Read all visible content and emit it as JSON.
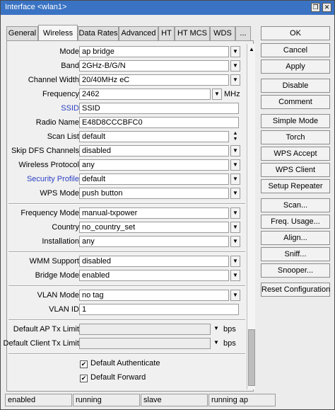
{
  "window": {
    "title": "Interface <wlan1>"
  },
  "tabs": [
    "General",
    "Wireless",
    "Data Rates",
    "Advanced",
    "HT",
    "HT MCS",
    "WDS",
    "..."
  ],
  "active_tab": "Wireless",
  "fields": {
    "mode": {
      "label": "Mode:",
      "value": "ap bridge"
    },
    "band": {
      "label": "Band:",
      "value": "2GHz-B/G/N"
    },
    "channel_width": {
      "label": "Channel Width:",
      "value": "20/40MHz eC"
    },
    "frequency": {
      "label": "Frequency:",
      "value": "2462",
      "unit": "MHz"
    },
    "ssid": {
      "label": "SSID:",
      "value": "SSID"
    },
    "radio_name": {
      "label": "Radio Name:",
      "value": "E48D8CCCBFC0"
    },
    "scan_list": {
      "label": "Scan List:",
      "value": "default"
    },
    "skip_dfs": {
      "label": "Skip DFS Channels:",
      "value": "disabled"
    },
    "wireless_protocol": {
      "label": "Wireless Protocol:",
      "value": "any"
    },
    "security_profile": {
      "label": "Security Profile:",
      "value": "default"
    },
    "wps_mode": {
      "label": "WPS Mode:",
      "value": "push button"
    },
    "frequency_mode": {
      "label": "Frequency Mode:",
      "value": "manual-txpower"
    },
    "country": {
      "label": "Country:",
      "value": "no_country_set"
    },
    "installation": {
      "label": "Installation:",
      "value": "any"
    },
    "wmm_support": {
      "label": "WMM Support:",
      "value": "disabled"
    },
    "bridge_mode": {
      "label": "Bridge Mode:",
      "value": "enabled"
    },
    "vlan_mode": {
      "label": "VLAN Mode:",
      "value": "no tag"
    },
    "vlan_id": {
      "label": "VLAN ID:",
      "value": "1"
    },
    "default_ap_tx_limit": {
      "label": "Default AP Tx Limit:",
      "value": "",
      "unit": "bps"
    },
    "default_client_tx_limit": {
      "label": "Default Client Tx Limit:",
      "value": "",
      "unit": "bps"
    }
  },
  "checkboxes": {
    "default_authenticate": {
      "label": "Default Authenticate",
      "checked": true
    },
    "default_forward": {
      "label": "Default Forward",
      "checked": true
    }
  },
  "buttons": [
    "OK",
    "Cancel",
    "Apply",
    "Disable",
    "Comment",
    "Simple Mode",
    "Torch",
    "WPS Accept",
    "WPS Client",
    "Setup Repeater",
    "Scan...",
    "Freq. Usage...",
    "Align...",
    "Sniff...",
    "Snooper...",
    "Reset Configuration"
  ],
  "status": [
    "enabled",
    "running",
    "slave",
    "running ap"
  ],
  "glyphs": {
    "dropdown": "▼",
    "up": "▲",
    "check": "✔",
    "close": "✕",
    "restore": "❐"
  },
  "colors": {
    "titlebar": "#3a73c4",
    "link_label": "#2a3fc4"
  }
}
